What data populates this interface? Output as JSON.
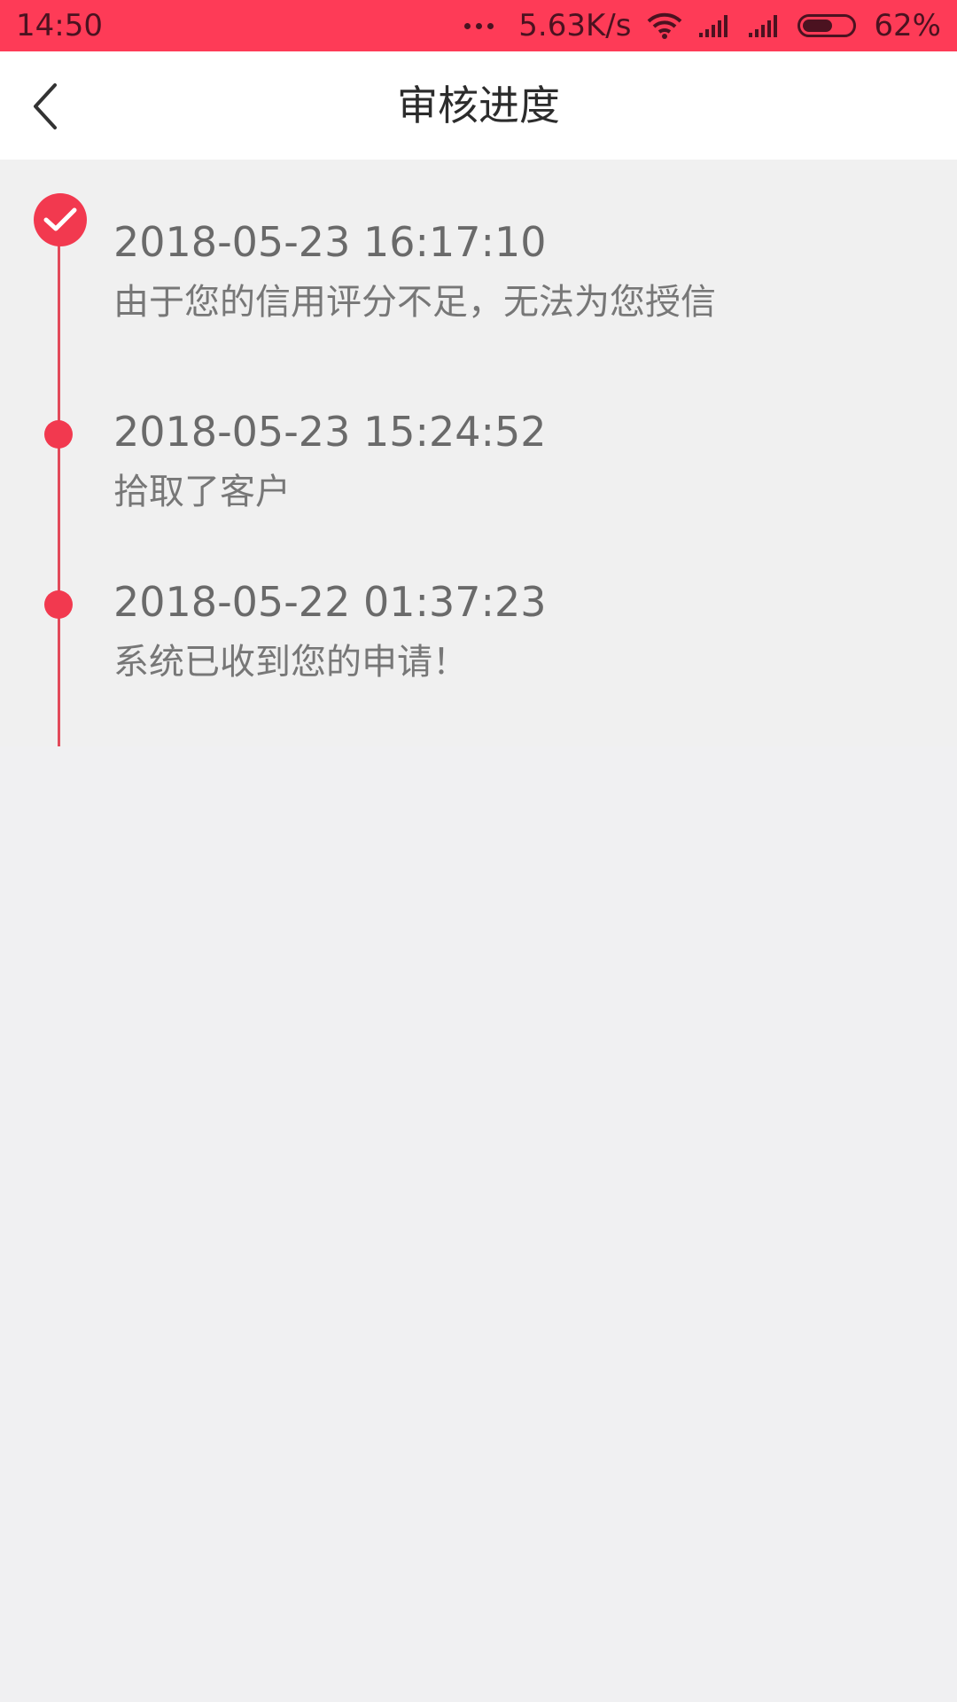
{
  "status_bar": {
    "time": "14:50",
    "net_speed": "5.63K/s",
    "battery_percent_text": "62%",
    "battery_level": 0.62,
    "icons": [
      "more-dots-icon",
      "wifi-icon",
      "signal-icon",
      "signal-icon",
      "battery-icon"
    ]
  },
  "header": {
    "title": "审核进度",
    "back_icon": "chevron-left-icon"
  },
  "timeline": {
    "items": [
      {
        "time": "2018-05-23 16:17:10",
        "description": "由于您的信用评分不足，无法为您授信",
        "status": "checked"
      },
      {
        "time": "2018-05-23 15:24:52",
        "description": "拾取了客户",
        "status": "dot"
      },
      {
        "time": "2018-05-22 01:37:23",
        "description": "系统已收到您的申请！",
        "status": "dot"
      }
    ]
  },
  "colors": {
    "accent": "#fe3b57",
    "node": "#f2394f",
    "line": "#e24a5a",
    "background": "#f0f0f2",
    "header_bg": "#ffffff"
  }
}
